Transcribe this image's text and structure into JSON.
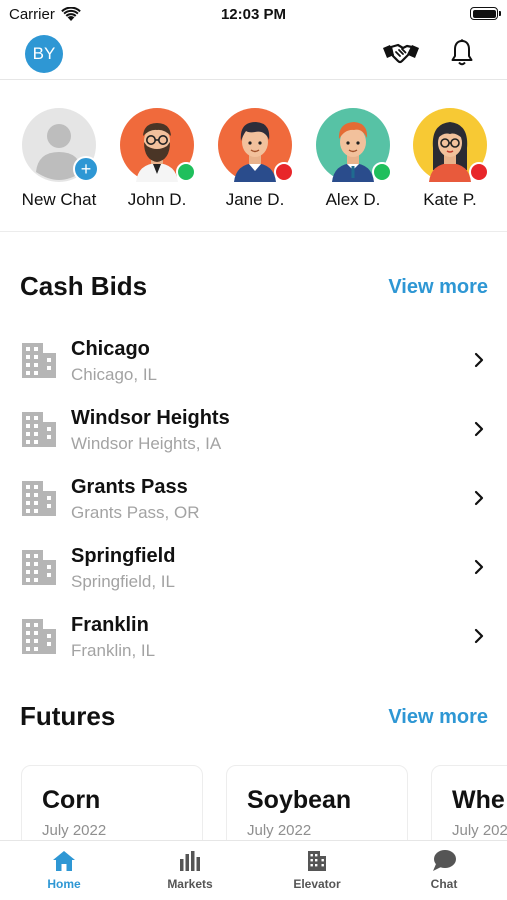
{
  "status_bar": {
    "carrier": "Carrier",
    "time": "12:03 PM",
    "battery_level": 1.0
  },
  "header": {
    "avatar_initials": "BY",
    "accent": "#2e97d4"
  },
  "chats": [
    {
      "name": "New Chat",
      "kind": "new"
    },
    {
      "name": "John D.",
      "status": "online",
      "status_color": "#1fbf5c",
      "bg": "#f06a3c"
    },
    {
      "name": "Jane D.",
      "status": "busy",
      "status_color": "#e8262a",
      "bg": "#f06a3c"
    },
    {
      "name": "Alex D.",
      "status": "online",
      "status_color": "#1fbf5c",
      "bg": "#57c2a5"
    },
    {
      "name": "Kate P.",
      "status": "busy",
      "status_color": "#e8262a",
      "bg": "#f7c934"
    }
  ],
  "cash_bids": {
    "title": "Cash Bids",
    "view_more": "View more",
    "items": [
      {
        "name": "Chicago",
        "location": "Chicago, IL"
      },
      {
        "name": "Windsor Heights",
        "location": "Windsor Heights, IA"
      },
      {
        "name": "Grants Pass",
        "location": "Grants Pass, OR"
      },
      {
        "name": "Springfield",
        "location": "Springfield, IL"
      },
      {
        "name": "Franklin",
        "location": "Franklin, IL"
      }
    ]
  },
  "futures": {
    "title": "Futures",
    "view_more": "View more",
    "cards": [
      {
        "name": "Corn",
        "month": "July 2022"
      },
      {
        "name": "Soybean",
        "month": "July 2022"
      },
      {
        "name": "Whe",
        "month": "July 202"
      }
    ]
  },
  "tabs": [
    {
      "label": "Home",
      "icon": "home-icon",
      "active": true
    },
    {
      "label": "Markets",
      "icon": "markets-icon",
      "active": false
    },
    {
      "label": "Elevator",
      "icon": "elevator-icon",
      "active": false
    },
    {
      "label": "Chat",
      "icon": "chat-icon",
      "active": false
    }
  ]
}
